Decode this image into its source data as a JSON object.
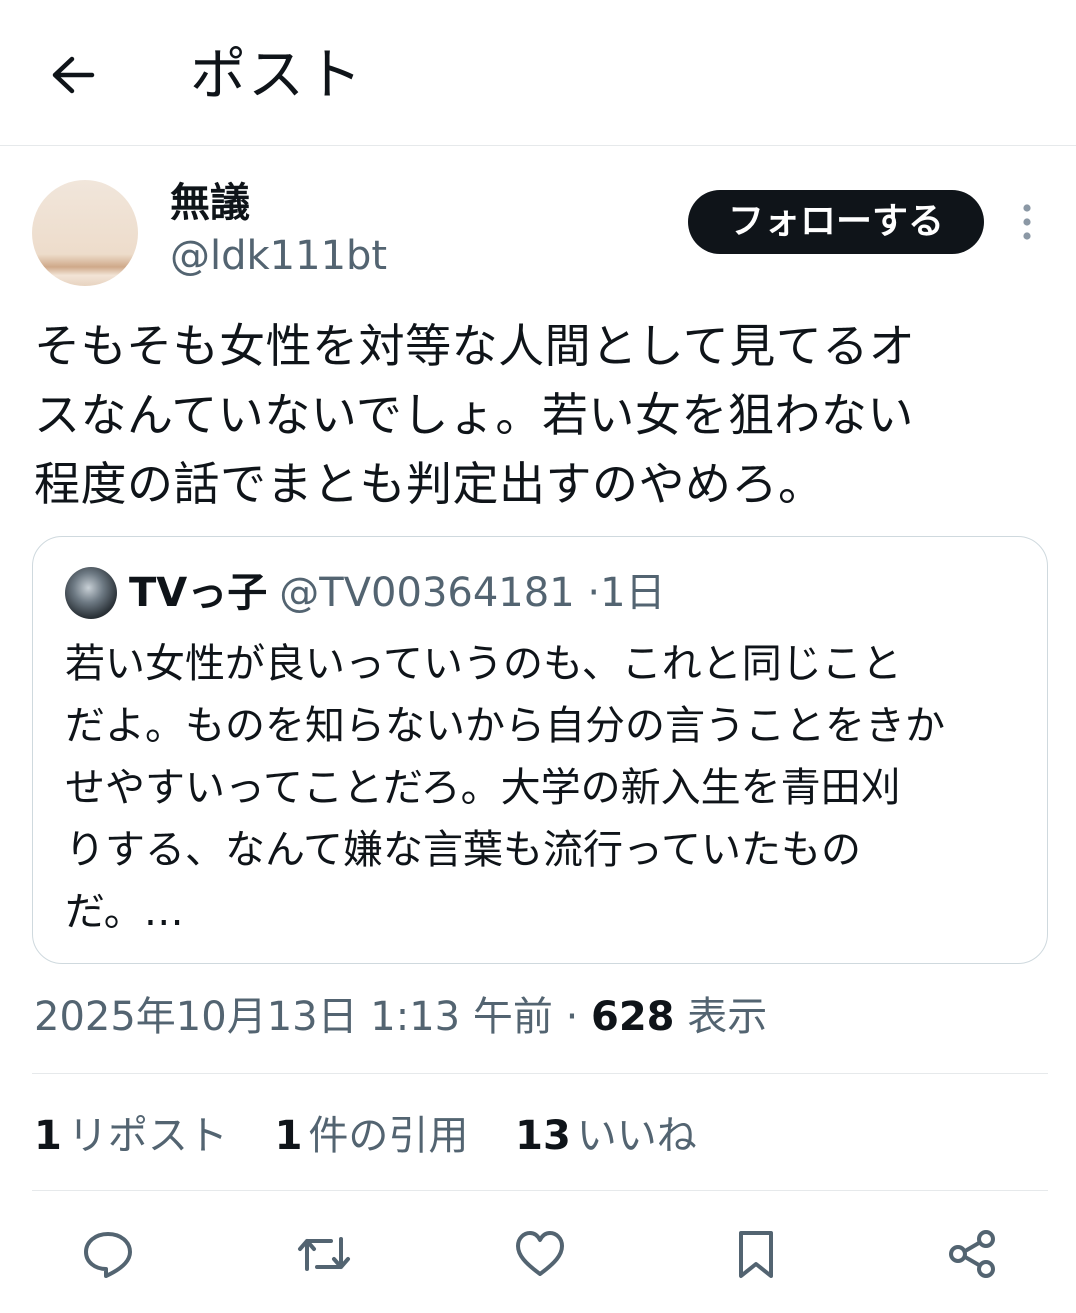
{
  "header": {
    "title": "ポスト"
  },
  "author": {
    "name": "無議",
    "handle": "@ldk111bt",
    "follow_label": "フォローする"
  },
  "post": {
    "text": "そもそも女性を対等な人間として見てるオ\nスなんていないでしょ。若い女を狙わない\n程度の話でまとも判定出すのやめろ。"
  },
  "quote": {
    "name": "TVっ子",
    "handle": "@TV00364181",
    "separator": "·",
    "time": "1日",
    "text": "若い女性が良いっていうのも、これと同じこと\nだよ。ものを知らないから自分の言うことをきか\nせやすいってことだろ。大学の新入生を青田刈\nりする、なんて嫌な言葉も流行っていたもの\nだ。…"
  },
  "meta": {
    "timestamp": "2025年10月13日 1:13 午前",
    "separator": "·",
    "views_count": "628",
    "views_label": "表示"
  },
  "stats": {
    "reposts_count": "1",
    "reposts_label": "リポスト",
    "quotes_count": "1",
    "quotes_label": "件の引用",
    "likes_count": "13",
    "likes_label": "いいね"
  },
  "icons": {
    "back": "arrow-left-icon",
    "more": "vertical-dots-icon",
    "reply": "speech-bubble-icon",
    "repost": "repost-arrows-icon",
    "like": "heart-icon",
    "bookmark": "bookmark-icon",
    "share": "share-nodes-icon"
  },
  "colors": {
    "text": "#0f1419",
    "secondary": "#536471",
    "border": "#cfd9de",
    "divider": "#e6e9eb",
    "follow_bg": "#0f1419",
    "follow_text": "#ffffff"
  }
}
